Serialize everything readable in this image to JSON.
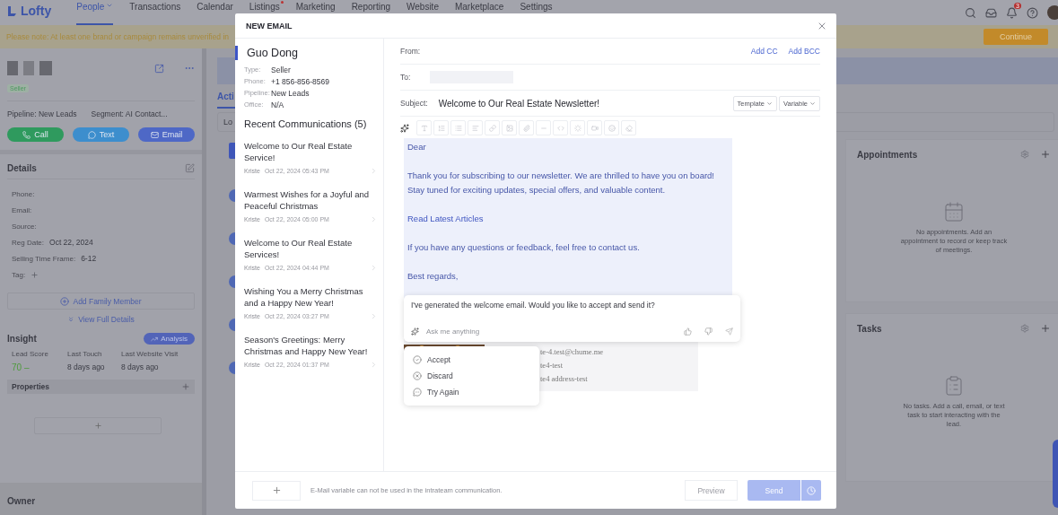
{
  "nav": {
    "logo": "Lofty",
    "items": [
      {
        "label": "People",
        "selected": true,
        "caret": true
      },
      {
        "label": "Transactions",
        "selected": false,
        "caret": false
      },
      {
        "label": "Calendar",
        "selected": false,
        "caret": false
      },
      {
        "label": "Listings",
        "selected": false,
        "caret": false,
        "dot": true
      },
      {
        "label": "Marketing",
        "selected": false,
        "caret": false
      },
      {
        "label": "Reporting",
        "selected": false,
        "caret": false
      },
      {
        "label": "Website",
        "selected": false,
        "caret": false
      },
      {
        "label": "Marketplace",
        "selected": false,
        "caret": false
      },
      {
        "label": "Settings",
        "selected": false,
        "caret": false
      }
    ],
    "notifications": "3"
  },
  "banner": {
    "text": "Please note: At least one brand or campaign remains unverified in",
    "button": "Continue"
  },
  "lead": {
    "tag": "Seller",
    "pipeline": "Pipeline: New Leads",
    "segment": "Segment: AI Contact...",
    "actions": [
      {
        "kind": "call",
        "label": "Call"
      },
      {
        "kind": "text",
        "label": "Text"
      },
      {
        "kind": "email",
        "label": "Email"
      }
    ],
    "details_title": "Details",
    "details": [
      {
        "label": "Phone:"
      },
      {
        "label": "Email:"
      },
      {
        "label": "Source:"
      },
      {
        "label": "Reg Date:",
        "value": "Oct 22, 2024"
      },
      {
        "label": "Selling Time Frame:",
        "value": "6-12"
      },
      {
        "label": "Tag:",
        "kind": "add"
      }
    ],
    "add_family": "Add Family Member",
    "view_full": "View Full Details",
    "insight_title": "Insight",
    "analysis": "Analysis",
    "stats": [
      {
        "label": "Lead Score",
        "value": "70 –",
        "kind": "score"
      },
      {
        "label": "Last Touch",
        "value": "8 days ago",
        "kind": "plain"
      },
      {
        "label": "Last Website Visit",
        "value": "8 days ago",
        "kind": "plain"
      }
    ],
    "properties": "Properties",
    "owner": "Owner"
  },
  "activity": {
    "tab": "Acti",
    "search": "Lo"
  },
  "side_cards": [
    {
      "kind": "calendar",
      "title": "Appointments",
      "empty": "No appointments. Add an appointment to record or keep track of meetings."
    },
    {
      "kind": "clipboard",
      "title": "Tasks",
      "empty": "No tasks. Add a call, email, or text task to start interacting with the lead."
    }
  ],
  "email": {
    "title": "NEW EMAIL",
    "contact": {
      "name": "Guo Dong",
      "fields": [
        {
          "label": "Type:",
          "value": "Seller"
        },
        {
          "label": "Phone:",
          "value": "+1 856-856-8569"
        },
        {
          "label": "Pipeline:",
          "value": "New Leads"
        },
        {
          "label": "Office:",
          "value": "N/A"
        }
      ]
    },
    "recent_title": "Recent Communications (5)",
    "recent": [
      {
        "title": "Welcome to Our Real Estate Service!",
        "author": "Kriste",
        "date": "Oct 22, 2024 05:43 PM"
      },
      {
        "title": "Warmest Wishes for a Joyful and Peaceful Christmas",
        "author": "Kriste",
        "date": "Oct 22, 2024 05:00 PM"
      },
      {
        "title": "Welcome to Our Real Estate Services!",
        "author": "Kriste",
        "date": "Oct 22, 2024 04:44 PM"
      },
      {
        "title": "Wishing You a Merry Christmas and a Happy New Year!",
        "author": "Kriste",
        "date": "Oct 22, 2024 03:27 PM"
      },
      {
        "title": "Season's Greetings: Merry Christmas and Happy New Year!",
        "author": "Kriste",
        "date": "Oct 22, 2024 01:37 PM"
      }
    ],
    "from_label": "From:",
    "add_cc": "Add CC",
    "add_bcc": "Add BCC",
    "to_label": "To:",
    "subject_label": "Subject:",
    "subject": "Welcome to Our Real Estate Newsletter!",
    "template": "Template",
    "variable": "Variable",
    "body": [
      {
        "kind": "greeting",
        "lines": [
          "Dear"
        ]
      },
      {
        "kind": "text",
        "lines": [
          "Thank you for subscribing to our newsletter. We are thrilled to have you on board!",
          "Stay tuned for exciting updates, special offers, and valuable content."
        ]
      },
      {
        "kind": "link",
        "lines": [
          "Read Latest Articles"
        ]
      },
      {
        "kind": "text",
        "lines": [
          "If you have any questions or feedback, feel free to contact us."
        ]
      },
      {
        "kind": "text",
        "lines": [
          "Best regards,"
        ]
      }
    ],
    "signature": [
      "te-4.test@chume.me",
      "te4-test",
      "te4 address-test"
    ],
    "assistant": {
      "message": "I've generated the welcome email. Would you like to accept and send it?",
      "placeholder": "Ask me anything"
    },
    "options": [
      {
        "kind": "accept",
        "label": "Accept"
      },
      {
        "kind": "discard",
        "label": "Discard"
      },
      {
        "kind": "retry",
        "label": "Try Again"
      }
    ],
    "footer_note": "E-Mail variable can not be used in the intrateam communication.",
    "preview": "Preview",
    "send": "Send",
    "send_disabled": true
  }
}
